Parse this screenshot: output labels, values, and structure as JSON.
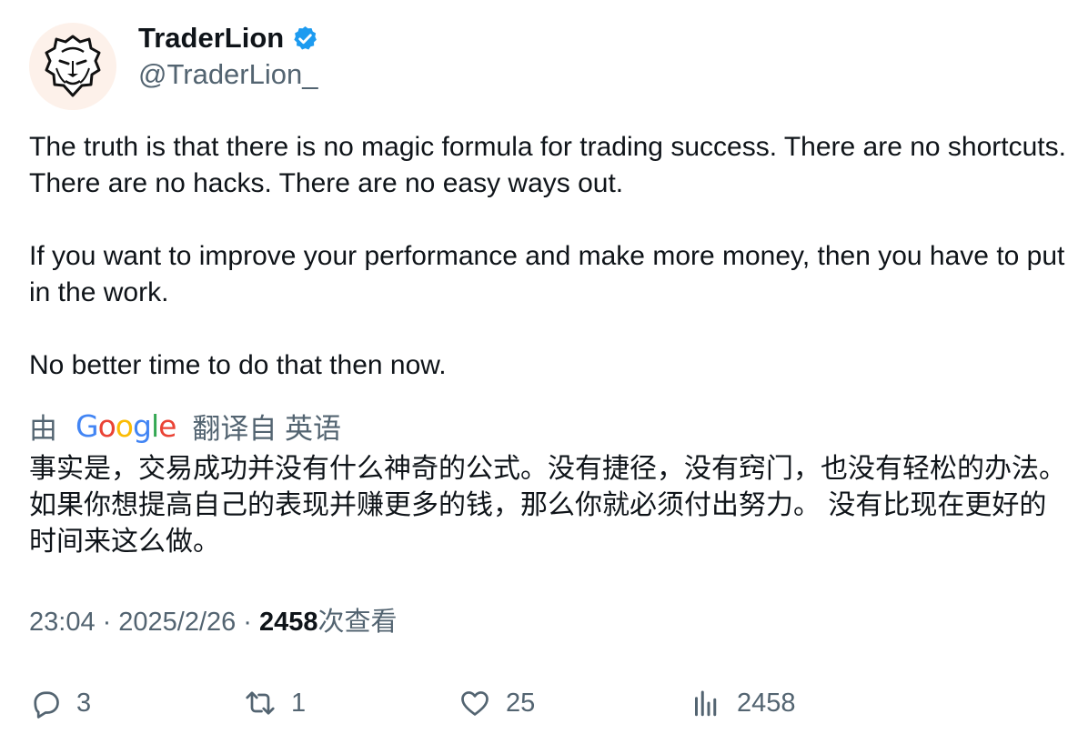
{
  "author": {
    "display_name": "TraderLion",
    "handle": "@TraderLion_",
    "verified_color": "#1d9bf0"
  },
  "tweet": {
    "text": "The truth is that there is no magic formula for trading success. There are no shortcuts. There are no hacks. There are no easy ways out.\n\nIf you want to improve your performance and make more money, then you have to put in the work.\n\nNo better time to do that then now."
  },
  "translation": {
    "prefix": "由",
    "provider": "Google",
    "suffix": "翻译自 英语",
    "text": "事实是，交易成功并没有什么神奇的公式。没有捷径，没有窍门，也没有轻松的办法。 如果你想提高自己的表现并赚更多的钱，那么你就必须付出努力。 没有比现在更好的时间来这么做。"
  },
  "meta": {
    "time": "23:04",
    "date": "2025/2/26",
    "views_count": "2458",
    "views_label": "次查看"
  },
  "actions": {
    "reply_count": "3",
    "retweet_count": "1",
    "like_count": "25",
    "views_count": "2458"
  },
  "icons": {
    "reply": "reply-icon",
    "retweet": "retweet-icon",
    "like": "heart-icon",
    "views": "analytics-icon",
    "verified": "verified-badge-icon",
    "avatar": "lion-logo"
  },
  "colors": {
    "text": "#0f1419",
    "secondary": "#536471",
    "google_blue": "#4285f4",
    "google_red": "#ea4335",
    "google_yellow": "#fbbc05",
    "google_green": "#34a853"
  }
}
